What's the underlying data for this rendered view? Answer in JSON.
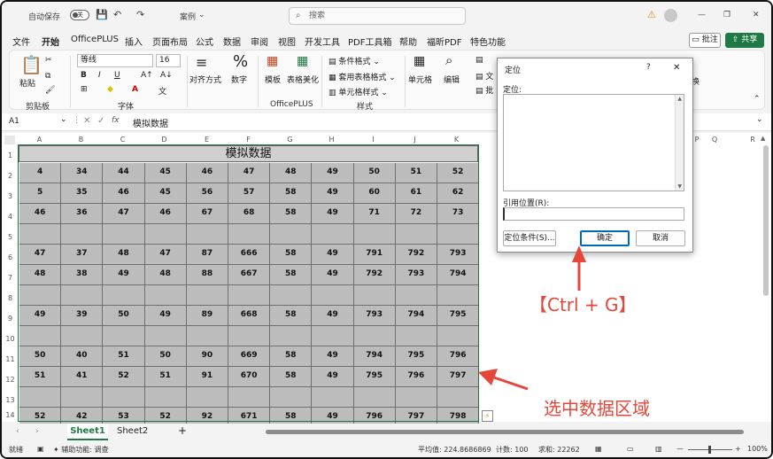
{
  "titlebar": {
    "autosave_label": "自动保存",
    "autosave_state": "关",
    "file_name": "案例",
    "search_placeholder": "搜索",
    "warning_icon": "warning-icon",
    "minimize": "—",
    "restore": "❐",
    "close": "✕"
  },
  "menu": {
    "items": [
      "文件",
      "开始",
      "OfficePLUS",
      "插入",
      "页面布局",
      "公式",
      "数据",
      "审阅",
      "视图",
      "开发工具",
      "PDF工具箱",
      "帮助",
      "福昕PDF",
      "特色功能"
    ],
    "comment_button": "批注",
    "share_button": "共享"
  },
  "ribbon": {
    "paste": "粘贴",
    "font_name": "等线",
    "font_size": "16",
    "bold": "B",
    "italic": "I",
    "underline": "U",
    "align": "对齐方式",
    "number": "数字",
    "template": "模板",
    "table_beautify": "表格美化",
    "conditional_format": "条件格式",
    "table_format": "套用表格格式",
    "cell_style": "单元格样式",
    "cells": "单元格",
    "editing": "编辑",
    "text_partial": "文",
    "batch_partial": "批",
    "replace_partial": "换",
    "groups": {
      "clipboard": "剪贴板",
      "font": "字体",
      "officeplus": "OfficePLUS",
      "style": "样式"
    }
  },
  "formula": {
    "name_box": "A1",
    "fx": "fx",
    "content": "模拟数据"
  },
  "sheet": {
    "columns": [
      "A",
      "B",
      "C",
      "D",
      "E",
      "F",
      "G",
      "H",
      "I",
      "J",
      "K",
      "",
      "",
      "O",
      "P",
      "Q",
      "R"
    ],
    "rows": [
      "1",
      "2",
      "3",
      "4",
      "5",
      "6",
      "7",
      "8",
      "9",
      "10",
      "11",
      "12",
      "13",
      "14"
    ],
    "title": "模拟数据",
    "data": [
      [
        "4",
        "34",
        "44",
        "45",
        "46",
        "47",
        "48",
        "49",
        "50",
        "51",
        "52"
      ],
      [
        "5",
        "35",
        "46",
        "45",
        "56",
        "57",
        "58",
        "49",
        "60",
        "61",
        "62"
      ],
      [
        "46",
        "36",
        "47",
        "46",
        "67",
        "68",
        "58",
        "49",
        "71",
        "72",
        "73"
      ],
      [
        "",
        "",
        "",
        "",
        "",
        "",
        "",
        "",
        "",
        "",
        ""
      ],
      [
        "47",
        "37",
        "48",
        "47",
        "87",
        "666",
        "58",
        "49",
        "791",
        "792",
        "793"
      ],
      [
        "48",
        "38",
        "49",
        "48",
        "88",
        "667",
        "58",
        "49",
        "792",
        "793",
        "794"
      ],
      [
        "",
        "",
        "",
        "",
        "",
        "",
        "",
        "",
        "",
        "",
        ""
      ],
      [
        "49",
        "39",
        "50",
        "49",
        "89",
        "668",
        "58",
        "49",
        "793",
        "794",
        "795"
      ],
      [
        "",
        "",
        "",
        "",
        "",
        "",
        "",
        "",
        "",
        "",
        ""
      ],
      [
        "50",
        "40",
        "51",
        "50",
        "90",
        "669",
        "58",
        "49",
        "794",
        "795",
        "796"
      ],
      [
        "51",
        "41",
        "52",
        "51",
        "91",
        "670",
        "58",
        "49",
        "795",
        "796",
        "797"
      ],
      [
        "",
        "",
        "",
        "",
        "",
        "",
        "",
        "",
        "",
        "",
        ""
      ],
      [
        "52",
        "42",
        "53",
        "52",
        "92",
        "671",
        "58",
        "49",
        "796",
        "797",
        "798"
      ]
    ]
  },
  "dialog": {
    "title": "定位",
    "help": "?",
    "close": "✕",
    "goto_label": "定位:",
    "ref_label": "引用位置(R):",
    "ref_value": "",
    "special_button": "定位条件(S)...",
    "ok_button": "确定",
    "cancel_button": "取消"
  },
  "annotations": {
    "shortcut": "【Ctrl + G】",
    "select_region": "选中数据区域",
    "accent_color": "#e7473a"
  },
  "tabs": {
    "sheets": [
      "Sheet1",
      "Sheet2"
    ],
    "add": "+"
  },
  "status": {
    "ready": "就绪",
    "accessibility": "辅助功能: 调查",
    "average": "平均值: 224.8686869",
    "count": "计数: 100",
    "sum": "求和: 22262",
    "zoom": "100%"
  }
}
